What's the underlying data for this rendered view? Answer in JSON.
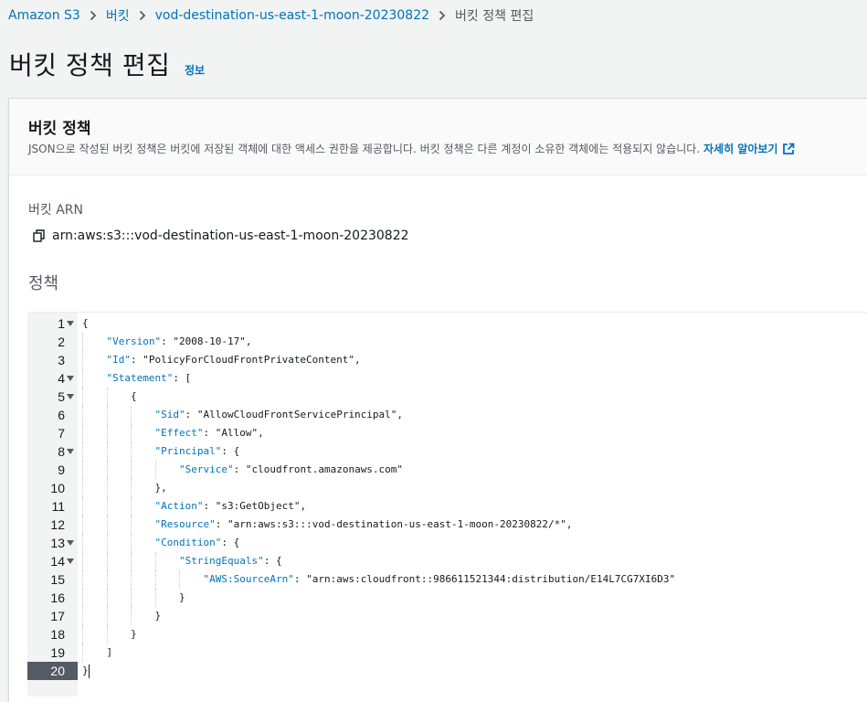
{
  "breadcrumb": {
    "items": [
      "Amazon S3",
      "버킷",
      "vod-destination-us-east-1-moon-20230822"
    ],
    "current": "버킷 정책 편집"
  },
  "page": {
    "title": "버킷 정책 편집",
    "info": "정보"
  },
  "panel": {
    "title": "버킷 정책",
    "description": "JSON으로 작성된 버킷 정책은 버킷에 저장된 객체에 대한 액세스 권한을 제공합니다. 버킷 정책은 다른 계정이 소유한 객체에는 적용되지 않습니다.",
    "learn_more": "자세히 알아보기"
  },
  "arn": {
    "label": "버킷 ARN",
    "value": "arn:aws:s3:::vod-destination-us-east-1-moon-20230822"
  },
  "policy": {
    "label": "정책"
  },
  "editor": {
    "active_line": 20,
    "lines": [
      {
        "n": "1",
        "fold": true,
        "indent": 0,
        "tokens": [
          [
            "p",
            "{"
          ]
        ]
      },
      {
        "n": "2",
        "fold": false,
        "indent": 1,
        "tokens": [
          [
            "k",
            "\"Version\""
          ],
          [
            "p",
            ": "
          ],
          [
            "s",
            "\"2008-10-17\""
          ],
          [
            "p",
            ","
          ]
        ]
      },
      {
        "n": "3",
        "fold": false,
        "indent": 1,
        "tokens": [
          [
            "k",
            "\"Id\""
          ],
          [
            "p",
            ": "
          ],
          [
            "s",
            "\"PolicyForCloudFrontPrivateContent\""
          ],
          [
            "p",
            ","
          ]
        ]
      },
      {
        "n": "4",
        "fold": true,
        "indent": 1,
        "tokens": [
          [
            "k",
            "\"Statement\""
          ],
          [
            "p",
            ": ["
          ]
        ]
      },
      {
        "n": "5",
        "fold": true,
        "indent": 2,
        "tokens": [
          [
            "p",
            "{"
          ]
        ]
      },
      {
        "n": "6",
        "fold": false,
        "indent": 3,
        "tokens": [
          [
            "k",
            "\"Sid\""
          ],
          [
            "p",
            ": "
          ],
          [
            "s",
            "\"AllowCloudFrontServicePrincipal\""
          ],
          [
            "p",
            ","
          ]
        ]
      },
      {
        "n": "7",
        "fold": false,
        "indent": 3,
        "tokens": [
          [
            "k",
            "\"Effect\""
          ],
          [
            "p",
            ": "
          ],
          [
            "s",
            "\"Allow\""
          ],
          [
            "p",
            ","
          ]
        ]
      },
      {
        "n": "8",
        "fold": true,
        "indent": 3,
        "tokens": [
          [
            "k",
            "\"Principal\""
          ],
          [
            "p",
            ": {"
          ]
        ]
      },
      {
        "n": "9",
        "fold": false,
        "indent": 4,
        "tokens": [
          [
            "k",
            "\"Service\""
          ],
          [
            "p",
            ": "
          ],
          [
            "s",
            "\"cloudfront.amazonaws.com\""
          ]
        ]
      },
      {
        "n": "10",
        "fold": false,
        "indent": 3,
        "tokens": [
          [
            "p",
            "},"
          ]
        ]
      },
      {
        "n": "11",
        "fold": false,
        "indent": 3,
        "tokens": [
          [
            "k",
            "\"Action\""
          ],
          [
            "p",
            ": "
          ],
          [
            "s",
            "\"s3:GetObject\""
          ],
          [
            "p",
            ","
          ]
        ]
      },
      {
        "n": "12",
        "fold": false,
        "indent": 3,
        "tokens": [
          [
            "k",
            "\"Resource\""
          ],
          [
            "p",
            ": "
          ],
          [
            "s",
            "\"arn:aws:s3:::vod-destination-us-east-1-moon-20230822/*\""
          ],
          [
            "p",
            ","
          ]
        ]
      },
      {
        "n": "13",
        "fold": true,
        "indent": 3,
        "tokens": [
          [
            "k",
            "\"Condition\""
          ],
          [
            "p",
            ": {"
          ]
        ]
      },
      {
        "n": "14",
        "fold": true,
        "indent": 4,
        "tokens": [
          [
            "k",
            "\"StringEquals\""
          ],
          [
            "p",
            ": {"
          ]
        ]
      },
      {
        "n": "15",
        "fold": false,
        "indent": 5,
        "tokens": [
          [
            "k",
            "\"AWS:SourceArn\""
          ],
          [
            "p",
            ": "
          ],
          [
            "s",
            "\"arn:aws:cloudfront::986611521344:distribution/E14L7CG7XI6D3\""
          ]
        ]
      },
      {
        "n": "16",
        "fold": false,
        "indent": 4,
        "tokens": [
          [
            "p",
            "}"
          ]
        ]
      },
      {
        "n": "17",
        "fold": false,
        "indent": 3,
        "tokens": [
          [
            "p",
            "}"
          ]
        ]
      },
      {
        "n": "18",
        "fold": false,
        "indent": 2,
        "tokens": [
          [
            "p",
            "}"
          ]
        ]
      },
      {
        "n": "19",
        "fold": false,
        "indent": 1,
        "tokens": [
          [
            "p",
            "]"
          ]
        ]
      },
      {
        "n": "20",
        "fold": false,
        "indent": 0,
        "tokens": [
          [
            "p",
            "}"
          ]
        ]
      }
    ]
  }
}
